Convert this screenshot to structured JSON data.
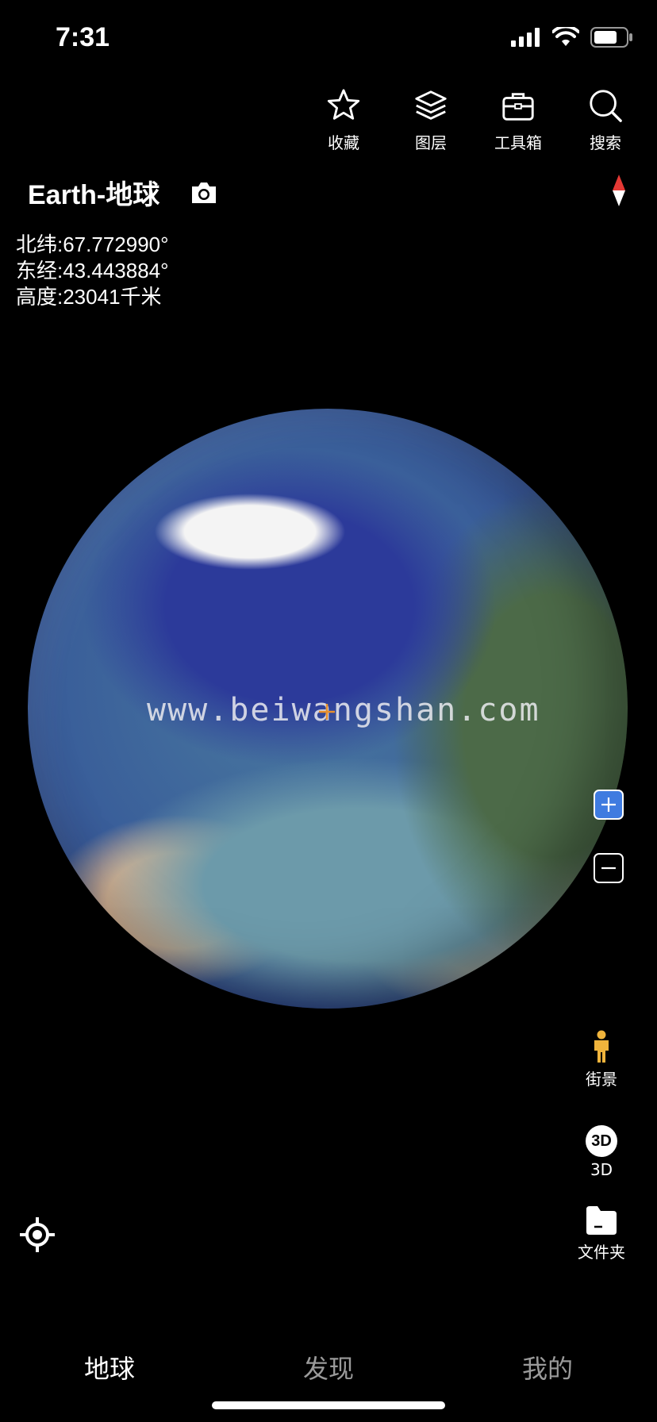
{
  "status_bar": {
    "time": "7:31"
  },
  "toolbar": {
    "items": [
      {
        "label": "收藏",
        "icon": "star-icon"
      },
      {
        "label": "图层",
        "icon": "layers-icon"
      },
      {
        "label": "工具箱",
        "icon": "toolbox-icon"
      },
      {
        "label": "搜索",
        "icon": "search-icon"
      }
    ]
  },
  "header": {
    "title": "Earth-地球"
  },
  "coordinates": {
    "latitude": "北纬:67.772990°",
    "longitude": "东经:43.443884°",
    "altitude": "高度:23041千米"
  },
  "watermark": "www.beiwangshan.com",
  "side_controls": {
    "street_view": "街景",
    "three_d_icon_text": "3D",
    "three_d": "3D",
    "folder": "文件夹"
  },
  "tabs": [
    {
      "label": "地球",
      "active": true
    },
    {
      "label": "发现",
      "active": false
    },
    {
      "label": "我的",
      "active": false
    }
  ],
  "colors": {
    "accent": "#3f7be0",
    "street_view_figure": "#f0b43c",
    "inactive_tab": "#9a9a9a"
  }
}
